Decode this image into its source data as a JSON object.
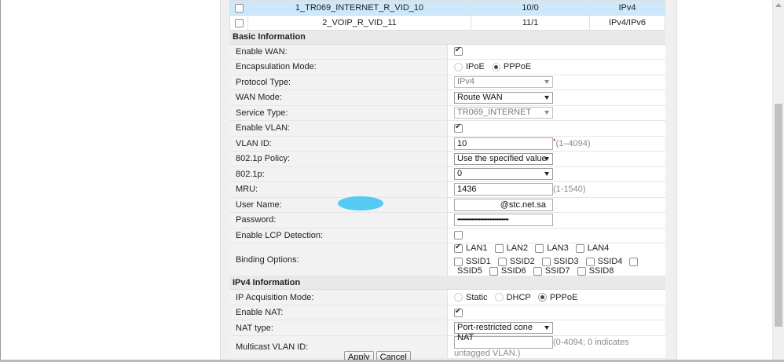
{
  "wan_list": [
    {
      "name": "1_TR069_INTERNET_R_VID_10",
      "vlan": "10/0",
      "ip": "IPv4",
      "selected": true
    },
    {
      "name": "2_VOIP_R_VID_11",
      "vlan": "11/1",
      "ip": "IPv4/IPv6",
      "selected": false
    }
  ],
  "basic": {
    "header": "Basic Information",
    "enable_wan_label": "Enable WAN:",
    "encap_label": "Encapsulation Mode:",
    "encap_ipoe": "IPoE",
    "encap_pppoe": "PPPoE",
    "protocol_label": "Protocol Type:",
    "protocol_value": "IPv4",
    "wan_mode_label": "WAN Mode:",
    "wan_mode_value": "Route WAN",
    "service_label": "Service Type:",
    "service_value": "TR069_INTERNET",
    "enable_vlan_label": "Enable VLAN:",
    "vlan_id_label": "VLAN ID:",
    "vlan_id_value": "10",
    "vlan_id_required": "*",
    "vlan_id_hint": "(1–4094)",
    "policy_label": "802.1p Policy:",
    "policy_value": "Use the specified value",
    "p8021_label": "802.1p:",
    "p8021_value": "0",
    "mru_label": "MRU:",
    "mru_value": "1436",
    "mru_hint": "(1-1540)",
    "username_label": "User Name:",
    "username_value": "@stc.net.sa",
    "password_label": "Password:",
    "password_value": "••••••••••••••••••••••••••••••••••••",
    "lcp_label": "Enable LCP Detection:",
    "binding_label": "Binding Options:",
    "lan_options": [
      "LAN1",
      "LAN2",
      "LAN3",
      "LAN4"
    ],
    "ssid_options": [
      "SSID1",
      "SSID2",
      "SSID3",
      "SSID4",
      "SSID5",
      "SSID6",
      "SSID7",
      "SSID8"
    ]
  },
  "ipv4": {
    "header": "IPv4 Information",
    "acq_label": "IP Acquisition Mode:",
    "acq_static": "Static",
    "acq_dhcp": "DHCP",
    "acq_pppoe": "PPPoE",
    "nat_label": "Enable NAT:",
    "nat_type_label": "NAT type:",
    "nat_type_value": "Port-restricted cone NAT",
    "mcast_label": "Multicast VLAN ID:",
    "mcast_value": "",
    "mcast_hint": "(0-4094; 0 indicates untagged VLAN.)"
  },
  "buttons": {
    "apply": "Apply",
    "cancel": "Cancel"
  }
}
